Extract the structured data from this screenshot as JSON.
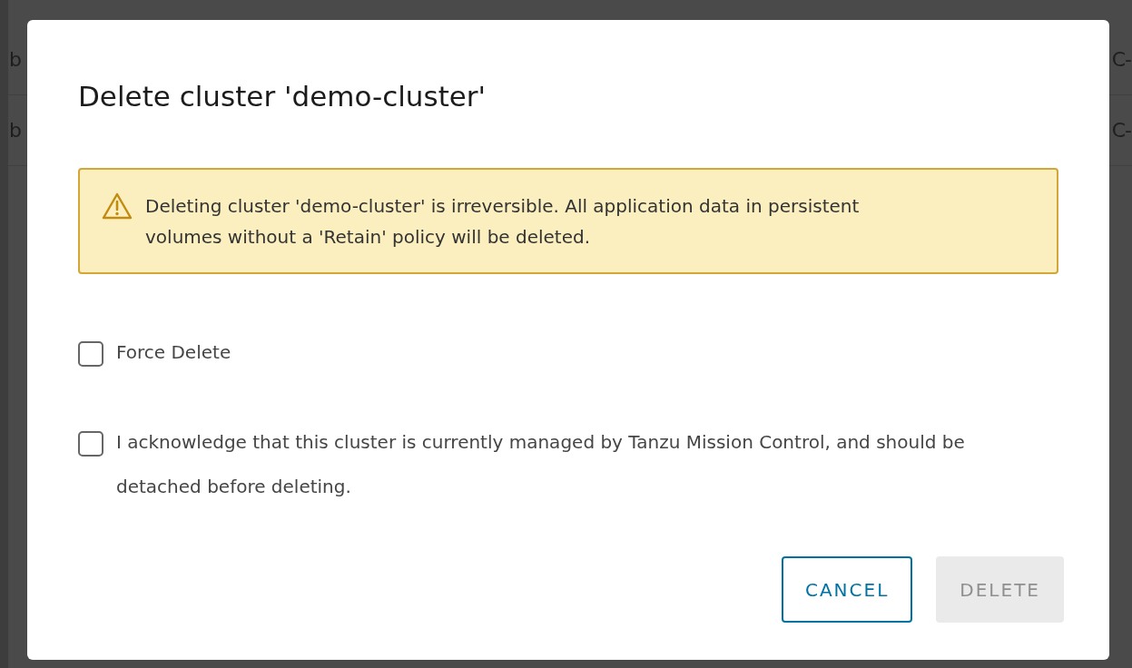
{
  "background_table": {
    "rows": [
      {
        "column_1": "b",
        "column_2": "C-"
      },
      {
        "column_1": "b",
        "column_2": "C-"
      }
    ]
  },
  "dialog": {
    "title": "Delete cluster 'demo-cluster'",
    "alert": {
      "kind": "warning",
      "text": "Deleting cluster 'demo-cluster' is irreversible. All application data in persistent volumes without a 'Retain' policy will be deleted."
    },
    "options": [
      {
        "label": "Force Delete",
        "checked": false
      },
      {
        "label": "I acknowledge that this cluster is currently managed by Tanzu Mission Control, and should be detached before deleting.",
        "checked": false
      }
    ],
    "buttons": [
      {
        "label": "CANCEL",
        "kind": "outline",
        "disabled": false
      },
      {
        "label": "DELETE",
        "kind": "primary",
        "disabled": true
      }
    ]
  }
}
